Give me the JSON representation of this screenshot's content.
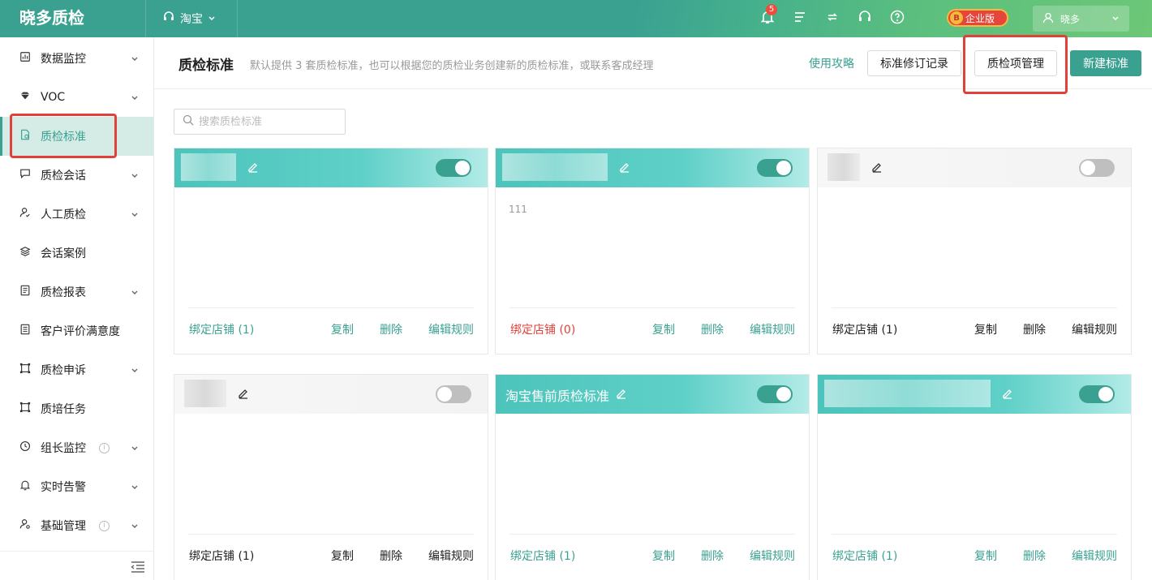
{
  "app": {
    "title": "晓多质检"
  },
  "shop_switch": {
    "label": "淘宝"
  },
  "notifications": {
    "count": "5"
  },
  "enterprise_badge": {
    "label": "企业版"
  },
  "user": {
    "name": "晓多"
  },
  "sidebar": {
    "items": [
      {
        "label": "数据监控",
        "icon": "bar-chart-icon",
        "has_chevron": true
      },
      {
        "label": "VOC",
        "icon": "diamond-icon",
        "has_chevron": true
      },
      {
        "label": "质检标准",
        "icon": "document-check-icon",
        "has_chevron": false,
        "active": true
      },
      {
        "label": "质检会话",
        "icon": "chat-bubble-icon",
        "has_chevron": true
      },
      {
        "label": "人工质检",
        "icon": "user-check-icon",
        "has_chevron": true
      },
      {
        "label": "会话案例",
        "icon": "layers-icon",
        "has_chevron": false
      },
      {
        "label": "质检报表",
        "icon": "report-icon",
        "has_chevron": true
      },
      {
        "label": "客户评价满意度",
        "icon": "list-doc-icon",
        "has_chevron": false
      },
      {
        "label": "质检申诉",
        "icon": "frame-icon",
        "has_chevron": true
      },
      {
        "label": "质培任务",
        "icon": "frame-icon",
        "has_chevron": false
      },
      {
        "label": "组长监控",
        "icon": "clock-icon",
        "has_chevron": true,
        "info": true
      },
      {
        "label": "实时告警",
        "icon": "bell-icon",
        "has_chevron": true
      },
      {
        "label": "基础管理",
        "icon": "user-settings-icon",
        "has_chevron": true,
        "info": true
      }
    ]
  },
  "header": {
    "title": "质检标准",
    "description": "默认提供 3 套质检标准，也可以根据您的质检业务创建新的质检标准，或联系客成经理",
    "guide_link": "使用攻略",
    "revision_button": "标准修订记录",
    "items_manage_button": "质检项管理",
    "new_button": "新建标准"
  },
  "search": {
    "placeholder": "搜索质检标准"
  },
  "cards": [
    {
      "title": "",
      "style": "teal",
      "enabled": true,
      "description": "",
      "shops_label": "绑定店铺 (1)",
      "shops_color": "teal",
      "actions_color": "teal"
    },
    {
      "title": "",
      "style": "teal",
      "enabled": true,
      "description": "111",
      "shops_label": "绑定店铺 (0)",
      "shops_color": "red",
      "actions_color": "teal"
    },
    {
      "title": "",
      "style": "gray",
      "enabled": false,
      "description": "",
      "shops_label": "绑定店铺 (1)",
      "shops_color": "dark",
      "actions_color": "dark"
    },
    {
      "title": "",
      "style": "gray",
      "enabled": false,
      "description": "",
      "shops_label": "绑定店铺 (1)",
      "shops_color": "dark",
      "actions_color": "dark"
    },
    {
      "title": "淘宝售前质检标准",
      "style": "teal",
      "enabled": true,
      "description": "",
      "shops_label": "绑定店铺 (1)",
      "shops_color": "teal",
      "actions_color": "teal"
    },
    {
      "title": "",
      "style": "teal",
      "enabled": true,
      "description": "",
      "shops_label": "绑定店铺 (1)",
      "shops_color": "teal",
      "actions_color": "teal"
    }
  ],
  "card_actions": {
    "copy": "复制",
    "delete": "删除",
    "edit_rules": "编辑规则"
  },
  "colors": {
    "primary": "#3aa191",
    "highlight": "#e0413b",
    "active_bg": "#d4ebe6"
  }
}
